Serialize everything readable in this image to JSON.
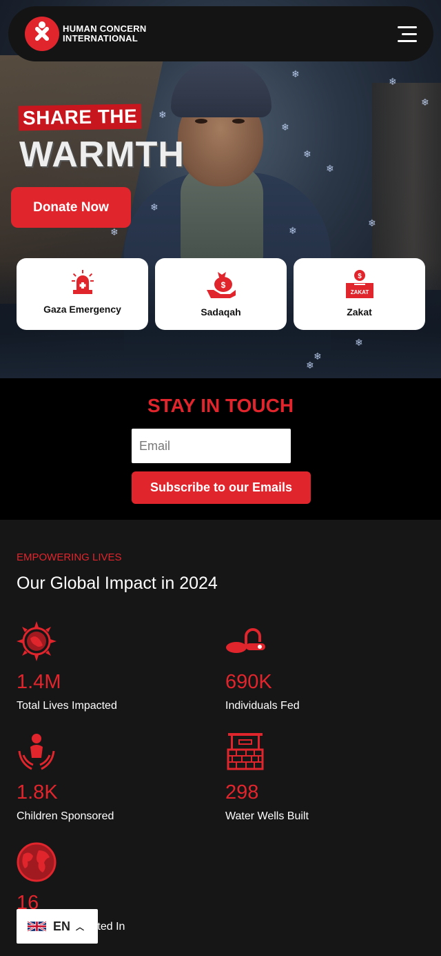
{
  "header": {
    "brand_line1": "HUMAN CONCERN",
    "brand_line2": "INTERNATIONAL"
  },
  "hero": {
    "headline_top": "SHARE THE",
    "headline_main": "WARMTH",
    "donate_label": "Donate Now",
    "quick_links": [
      {
        "label": "Gaza Emergency",
        "icon": "siren-icon"
      },
      {
        "label": "Sadaqah",
        "icon": "charity-bag-icon"
      },
      {
        "label": "Zakat",
        "icon": "zakat-box-icon"
      }
    ],
    "zakat_icon_text": "ZAKAT"
  },
  "newsletter": {
    "title": "STAY IN TOUCH",
    "email_placeholder": "Email",
    "subscribe_label": "Subscribe to our Emails"
  },
  "impact": {
    "kicker": "EMPOWERING LIVES",
    "title": "Our Global Impact in 2024",
    "stats": [
      {
        "value": "1.4M",
        "caption": "Total Lives Impacted",
        "icon": "sun-globe-icon"
      },
      {
        "value": "690K",
        "caption": "Individuals Fed",
        "icon": "food-icon"
      },
      {
        "value": "1.8K",
        "caption": "Children Sponsored",
        "icon": "child-in-hands-icon"
      },
      {
        "value": "298",
        "caption": "Water Wells Built",
        "icon": "water-well-icon"
      },
      {
        "value": "16",
        "caption": "Countries Operated In",
        "icon": "world-icon"
      }
    ]
  },
  "language": {
    "code": "EN"
  },
  "colors": {
    "accent": "#e1252d",
    "dark": "#161616"
  }
}
